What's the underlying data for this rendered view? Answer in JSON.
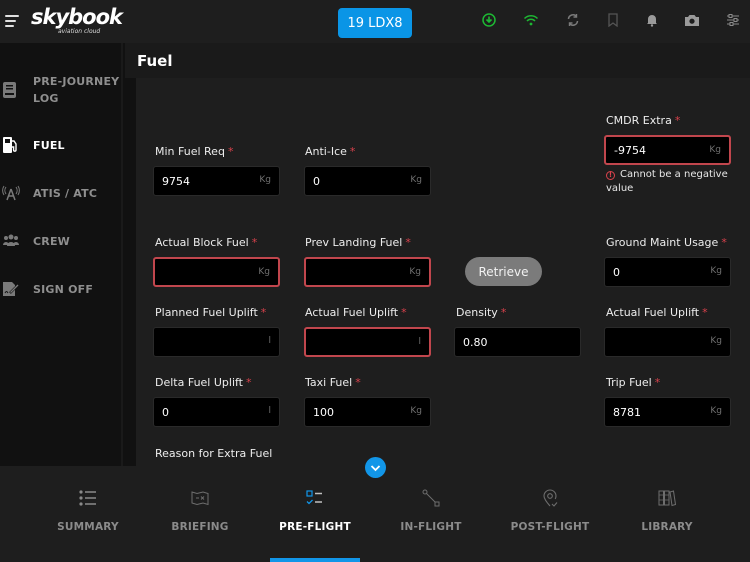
{
  "app": {
    "logo": "skybook",
    "logo_subtitle": "aviation cloud",
    "flight_button": "19 LDX8"
  },
  "topbar_icons": [
    "download-icon",
    "wifi-icon",
    "sync-icon",
    "bookmark-icon",
    "bell-icon",
    "camera-icon",
    "settings-sliders-icon"
  ],
  "colors": {
    "accent": "#0a95e6",
    "status_green": "#1db933",
    "error": "#c1464d"
  },
  "sidebar": {
    "items": [
      {
        "label_line1": "PRE-JOURNEY",
        "label_line2": "LOG",
        "icon": "logbook-icon",
        "active": false
      },
      {
        "label": "FUEL",
        "icon": "fuel-pump-icon",
        "active": true
      },
      {
        "label": "ATIS / ATC",
        "icon": "radio-tower-icon",
        "active": false
      },
      {
        "label": "CREW",
        "icon": "crew-icon",
        "active": false
      },
      {
        "label": "SIGN OFF",
        "icon": "sign-off-icon",
        "active": false
      }
    ]
  },
  "page": {
    "title": "Fuel"
  },
  "form": {
    "min_fuel_req": {
      "label": "Min Fuel Req",
      "value": "9754",
      "unit": "Kg"
    },
    "anti_ice": {
      "label": "Anti-Ice",
      "value": "0",
      "unit": "Kg"
    },
    "cmdr_extra": {
      "label": "CMDR Extra",
      "value": "-9754",
      "unit": "Kg",
      "error": "Cannot be a negative value"
    },
    "actual_block_fuel": {
      "label": "Actual Block Fuel",
      "value": "",
      "unit": "Kg"
    },
    "prev_landing_fuel": {
      "label": "Prev Landing Fuel",
      "value": "",
      "unit": "Kg"
    },
    "retrieve_label": "Retrieve",
    "ground_maint_usage": {
      "label": "Ground Maint Usage",
      "value": "0",
      "unit": "Kg"
    },
    "planned_fuel_uplift": {
      "label": "Planned Fuel Uplift",
      "value": "",
      "unit": "l"
    },
    "actual_fuel_uplift_l": {
      "label": "Actual Fuel Uplift",
      "value": "",
      "unit": "l"
    },
    "density": {
      "label": "Density",
      "value": "0.80"
    },
    "actual_fuel_uplift_kg": {
      "label": "Actual Fuel Uplift",
      "value": "",
      "unit": "Kg"
    },
    "delta_fuel_uplift": {
      "label": "Delta Fuel Uplift",
      "value": "0",
      "unit": "l"
    },
    "taxi_fuel": {
      "label": "Taxi Fuel",
      "value": "100",
      "unit": "Kg"
    },
    "trip_fuel": {
      "label": "Trip Fuel",
      "value": "8781",
      "unit": "Kg"
    },
    "reason_extra_fuel": {
      "label": "Reason for Extra Fuel"
    },
    "required_marker": "*"
  },
  "bottom_nav": {
    "tabs": [
      {
        "label": "SUMMARY",
        "icon": "list-icon",
        "active": false
      },
      {
        "label": "BRIEFING",
        "icon": "map-icon",
        "active": false
      },
      {
        "label": "PRE-FLIGHT",
        "icon": "checklist-icon",
        "active": true
      },
      {
        "label": "IN-FLIGHT",
        "icon": "route-icon",
        "active": false
      },
      {
        "label": "POST-FLIGHT",
        "icon": "location-check-icon",
        "active": false
      },
      {
        "label": "LIBRARY",
        "icon": "library-icon",
        "active": false
      }
    ]
  }
}
